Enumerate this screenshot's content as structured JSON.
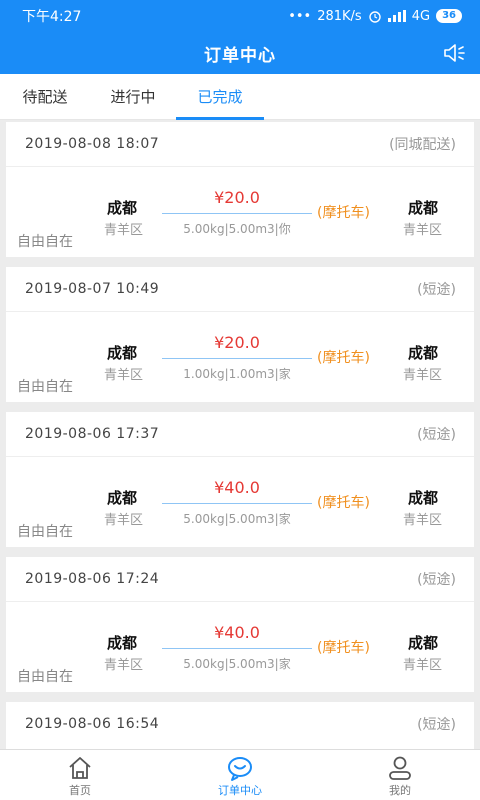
{
  "status_bar": {
    "time": "下午4:27",
    "speed": "281K/s",
    "network": "4G",
    "battery": "36"
  },
  "header": {
    "title": "订单中心"
  },
  "tabs": [
    {
      "label": "待配送"
    },
    {
      "label": "进行中"
    },
    {
      "label": "已完成"
    }
  ],
  "orders": [
    {
      "date": "2019-08-08 18:07",
      "type": "(同城配送)",
      "user": "自由自在",
      "from_city": "成都",
      "from_district": "青羊区",
      "to_city": "成都",
      "to_district": "青羊区",
      "price": "¥20.0",
      "spec": "5.00kg|5.00m3|你",
      "vehicle": "(摩托车)"
    },
    {
      "date": "2019-08-07 10:49",
      "type": "(短途)",
      "user": "自由自在",
      "from_city": "成都",
      "from_district": "青羊区",
      "to_city": "成都",
      "to_district": "青羊区",
      "price": "¥20.0",
      "spec": "1.00kg|1.00m3|家",
      "vehicle": "(摩托车)"
    },
    {
      "date": "2019-08-06 17:37",
      "type": "(短途)",
      "user": "自由自在",
      "from_city": "成都",
      "from_district": "青羊区",
      "to_city": "成都",
      "to_district": "青羊区",
      "price": "¥40.0",
      "spec": "5.00kg|5.00m3|家",
      "vehicle": "(摩托车)"
    },
    {
      "date": "2019-08-06 17:24",
      "type": "(短途)",
      "user": "自由自在",
      "from_city": "成都",
      "from_district": "青羊区",
      "to_city": "成都",
      "to_district": "青羊区",
      "price": "¥40.0",
      "spec": "5.00kg|5.00m3|家",
      "vehicle": "(摩托车)"
    },
    {
      "date": "2019-08-06 16:54",
      "type": "(短途)"
    }
  ],
  "bottom_nav": [
    {
      "label": "首页",
      "icon": "home-icon"
    },
    {
      "label": "订单中心",
      "icon": "chat-bubble-icon"
    },
    {
      "label": "我的",
      "icon": "person-icon"
    }
  ],
  "colors": {
    "primary": "#1a8cf7",
    "price": "#e53935",
    "vehicle": "#f08f1e"
  }
}
